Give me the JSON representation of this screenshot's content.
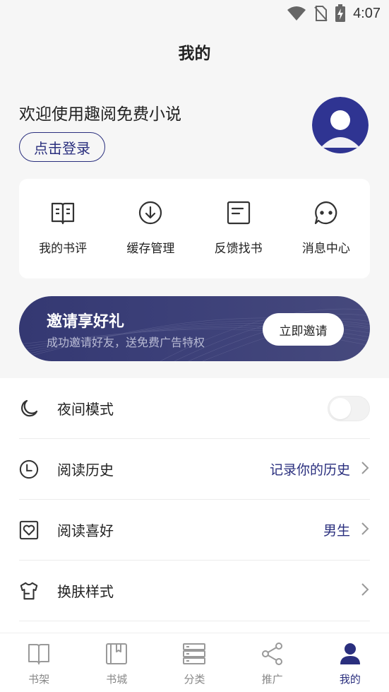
{
  "status_bar": {
    "time": "4:07",
    "icons": [
      "wifi-icon",
      "no-sim-icon",
      "battery-charging-icon"
    ]
  },
  "header": {
    "title": "我的"
  },
  "profile": {
    "welcome_text": "欢迎使用趣阅免费小说",
    "login_label": "点击登录",
    "avatar_icon": "user-avatar-icon"
  },
  "quick_actions": [
    {
      "label": "我的书评",
      "icon": "book-review-icon"
    },
    {
      "label": "缓存管理",
      "icon": "download-icon"
    },
    {
      "label": "反馈找书",
      "icon": "feedback-icon"
    },
    {
      "label": "消息中心",
      "icon": "message-icon"
    }
  ],
  "invite": {
    "title": "邀请享好礼",
    "subtitle": "成功邀请好友，送免费广告特权",
    "button_label": "立即邀请"
  },
  "settings": [
    {
      "label": "夜间模式",
      "icon": "moon-icon",
      "type": "toggle",
      "enabled": false
    },
    {
      "label": "阅读历史",
      "icon": "clock-icon",
      "value": "记录你的历史"
    },
    {
      "label": "阅读喜好",
      "icon": "heart-icon",
      "value": "男生"
    },
    {
      "label": "换肤样式",
      "icon": "tshirt-icon",
      "value": ""
    }
  ],
  "tabs": [
    {
      "label": "书架",
      "icon": "bookshelf-icon",
      "active": false
    },
    {
      "label": "书城",
      "icon": "bookstore-icon",
      "active": false
    },
    {
      "label": "分类",
      "icon": "category-icon",
      "active": false
    },
    {
      "label": "推广",
      "icon": "share-icon",
      "active": false
    },
    {
      "label": "我的",
      "icon": "profile-icon",
      "active": true
    }
  ],
  "colors": {
    "accent": "#2a2f7e",
    "background": "#f6f6f6",
    "banner": "#3b3f78",
    "tab_inactive": "#888888"
  }
}
